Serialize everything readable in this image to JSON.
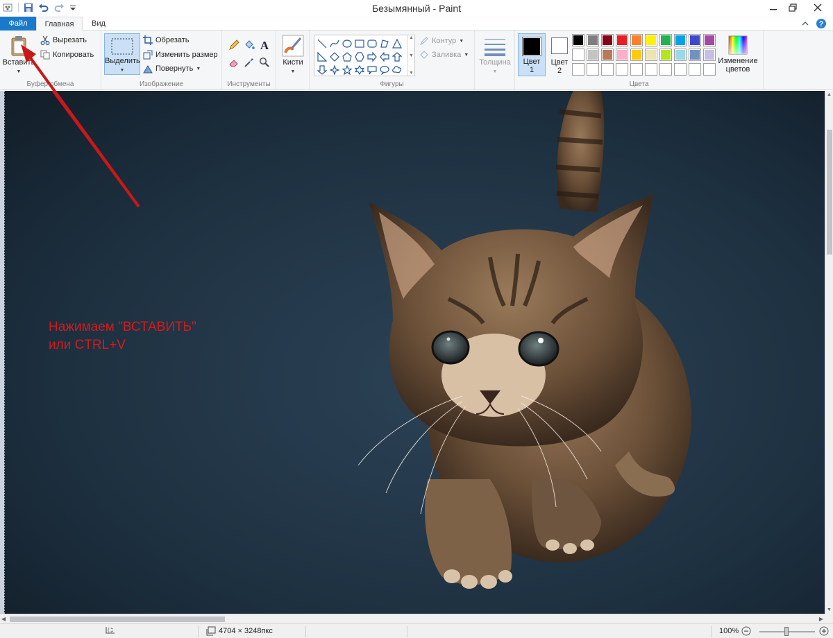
{
  "window": {
    "title": "Безымянный - Paint"
  },
  "tabs": [
    {
      "label": "Файл"
    },
    {
      "label": "Главная"
    },
    {
      "label": "Вид"
    }
  ],
  "ribbon": {
    "clipboard": {
      "group_label": "Буфер обмена",
      "paste_label": "Вставить",
      "cut_label": "Вырезать",
      "copy_label": "Копировать"
    },
    "image": {
      "group_label": "Изображение",
      "select_label": "Выделить",
      "crop_label": "Обрезать",
      "resize_label": "Изменить размер",
      "rotate_label": "Повернуть"
    },
    "tools": {
      "group_label": "Инструменты"
    },
    "brushes": {
      "label": "Кисти"
    },
    "shapes": {
      "group_label": "Фигуры",
      "outline_label": "Контур",
      "fill_label": "Заливка"
    },
    "size": {
      "label": "Толщина"
    },
    "colors": {
      "group_label": "Цвета",
      "color1_label": "Цвет 1",
      "color2_label": "Цвет 2",
      "edit_colors_label": "Изменение цветов",
      "color1": "#000000",
      "color2": "#ffffff",
      "palette_row1": [
        "#000000",
        "#7f7f7f",
        "#880015",
        "#ed1c24",
        "#ff7f27",
        "#fff200",
        "#22b14c",
        "#00a2e8",
        "#3f48cc",
        "#a349a4"
      ],
      "palette_row2": [
        "#ffffff",
        "#c3c3c3",
        "#b97a57",
        "#ffaec9",
        "#ffc90e",
        "#efe4b0",
        "#b5e61d",
        "#99d9ea",
        "#7092be",
        "#c8bfe7"
      ],
      "palette_row3": [
        "#ffffff",
        "#ffffff",
        "#ffffff",
        "#ffffff",
        "#ffffff",
        "#ffffff",
        "#ffffff",
        "#ffffff",
        "#ffffff",
        "#ffffff"
      ]
    }
  },
  "annotation": {
    "text": "Нажимаем \"ВСТАВИТЬ\"\nили CTRL+V",
    "color": "#d41a1a"
  },
  "statusbar": {
    "image_size": "4704 × 3248пкс",
    "zoom": "100%"
  }
}
